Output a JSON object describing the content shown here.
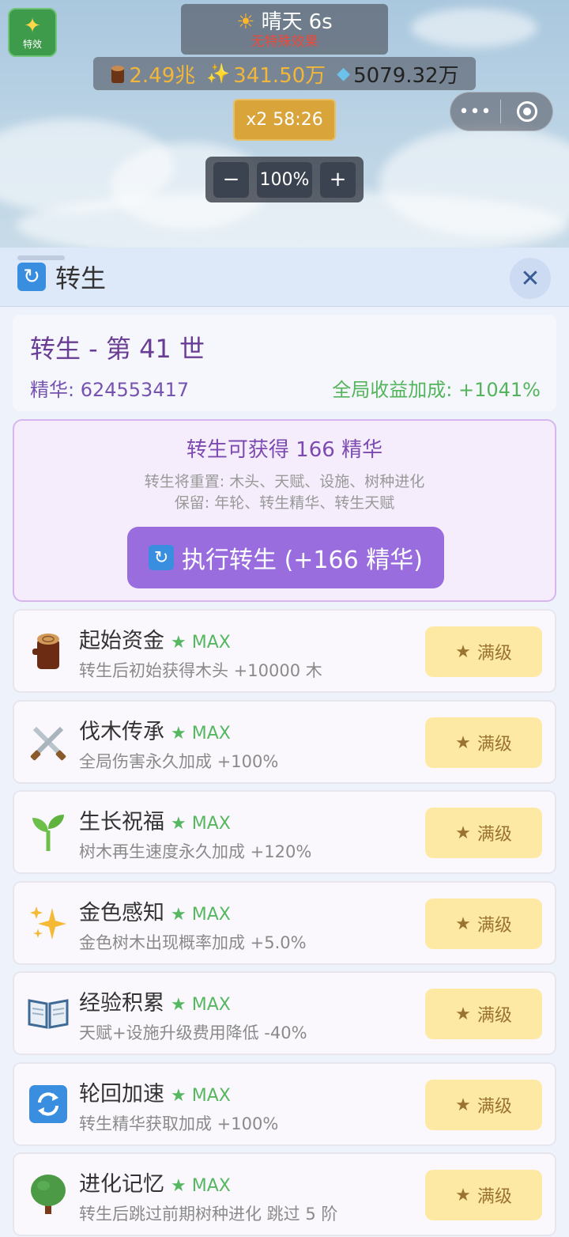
{
  "top": {
    "fx_label": "特效",
    "weather": {
      "name": "晴天",
      "time": "6s",
      "effect": "无特殊效果"
    },
    "resources": {
      "wood": "2.49兆",
      "sparkle": "341.50万",
      "gem": "5079.32万"
    },
    "boost": "x2 58:26",
    "zoom": {
      "minus": "−",
      "value": "100%",
      "plus": "+"
    },
    "capsule": {
      "more": "•••"
    }
  },
  "panel": {
    "title": "转生",
    "close": "✕",
    "summary": {
      "heading": "转生 - 第 41 世",
      "essence": "精华: 624553417",
      "bonus": "全局收益加成: +1041%"
    },
    "rebirth": {
      "gain": "转生可获得 166 精华",
      "reset": "转生将重置: 木头、天赋、设施、树种进化",
      "keep": "保留: 年轮、转生精华、转生天赋",
      "button": "执行转生 (+166 精华)"
    },
    "max_label": "★ MAX",
    "full_label": "满级",
    "items": [
      {
        "name": "起始资金",
        "desc": "转生后初始获得木头 +10000 木",
        "icon": "wood-log-icon"
      },
      {
        "name": "伐木传承",
        "desc": "全局伤害永久加成 +100%",
        "icon": "crossed-swords-icon"
      },
      {
        "name": "生长祝福",
        "desc": "树木再生速度永久加成 +120%",
        "icon": "seedling-icon"
      },
      {
        "name": "金色感知",
        "desc": "金色树木出现概率加成 +5.0%",
        "icon": "sparkles-icon"
      },
      {
        "name": "经验积累",
        "desc": "天赋+设施升级费用降低 -40%",
        "icon": "open-book-icon"
      },
      {
        "name": "轮回加速",
        "desc": "转生精华获取加成 +100%",
        "icon": "cycle-icon"
      },
      {
        "name": "进化记忆",
        "desc": "转生后跳过前期树种进化 跳过 5 阶",
        "icon": "tree-icon"
      }
    ]
  },
  "colors": {
    "accent_purple": "#9a6ddf",
    "max_green": "#55b760",
    "full_btn_bg": "#fde9a4"
  }
}
